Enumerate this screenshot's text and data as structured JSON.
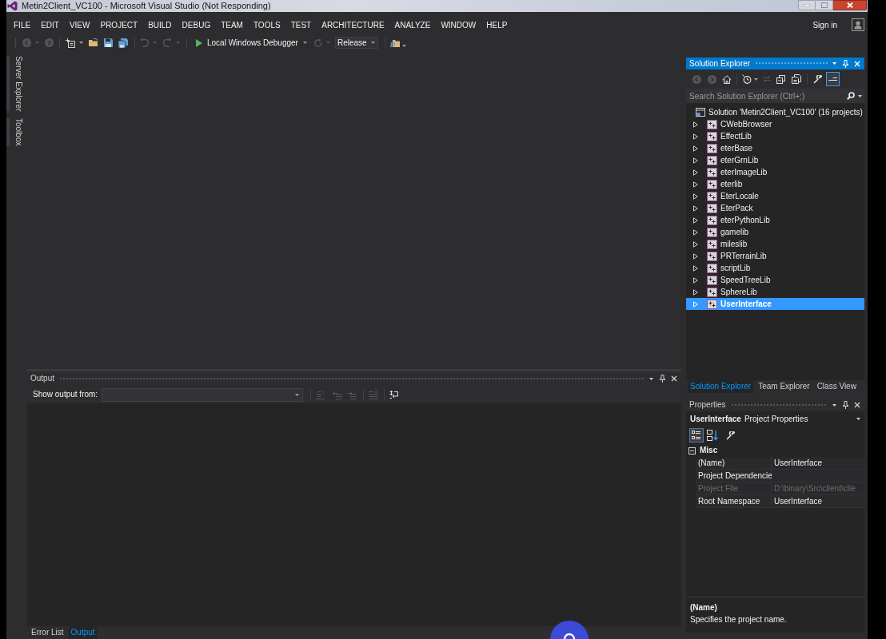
{
  "window": {
    "title": "Metin2Client_VC100 - Microsoft Visual Studio (Not Responding)"
  },
  "menu": [
    "FILE",
    "EDIT",
    "VIEW",
    "PROJECT",
    "BUILD",
    "DEBUG",
    "TEAM",
    "TOOLS",
    "TEST",
    "ARCHITECTURE",
    "ANALYZE",
    "WINDOW",
    "HELP"
  ],
  "account": {
    "sign_in": "Sign in"
  },
  "toolbar": {
    "start_debugging": "Local Windows Debugger",
    "configuration": "Release"
  },
  "side_tabs": [
    "Server Explorer",
    "Toolbox"
  ],
  "solution_explorer": {
    "title": "Solution Explorer",
    "active": true,
    "search": {
      "placeholder": "Search Solution Explorer (Ctrl+;)"
    },
    "solution": "Solution 'Metin2Client_VC100' (16 projects)",
    "projects": [
      {
        "name": "CWebBrowser",
        "expanded": false,
        "selected": false
      },
      {
        "name": "EffectLib",
        "expanded": false,
        "selected": false
      },
      {
        "name": "eterBase",
        "expanded": false,
        "selected": false
      },
      {
        "name": "eterGrnLib",
        "expanded": false,
        "selected": false
      },
      {
        "name": "eterImageLib",
        "expanded": false,
        "selected": false
      },
      {
        "name": "eterlib",
        "expanded": false,
        "selected": false
      },
      {
        "name": "EterLocale",
        "expanded": false,
        "selected": false
      },
      {
        "name": "EterPack",
        "expanded": false,
        "selected": false
      },
      {
        "name": "eterPythonLib",
        "expanded": false,
        "selected": false
      },
      {
        "name": "gamelib",
        "expanded": false,
        "selected": false
      },
      {
        "name": "mileslib",
        "expanded": false,
        "selected": false
      },
      {
        "name": "PRTerrainLib",
        "expanded": false,
        "selected": false
      },
      {
        "name": "scriptLib",
        "expanded": false,
        "selected": false
      },
      {
        "name": "SpeedTreeLib",
        "expanded": false,
        "selected": false
      },
      {
        "name": "SphereLib",
        "expanded": false,
        "selected": false
      },
      {
        "name": "UserInterface",
        "expanded": false,
        "selected": true
      }
    ],
    "tabs": [
      {
        "label": "Solution Explorer",
        "selected": true
      },
      {
        "label": "Team Explorer",
        "selected": false
      },
      {
        "label": "Class View",
        "selected": false
      }
    ]
  },
  "output": {
    "title": "Output",
    "active": false,
    "source_label": "Show output from:",
    "tabs": [
      {
        "label": "Error List",
        "selected": false
      },
      {
        "label": "Output",
        "selected": true
      }
    ]
  },
  "properties": {
    "title": "Properties",
    "active": false,
    "object": {
      "name": "UserInterface",
      "type": "Project Properties"
    },
    "category": {
      "label": "Misc",
      "expanded": true
    },
    "rows": [
      {
        "name": "(Name)",
        "value": "UserInterface",
        "disabled": false
      },
      {
        "name": "Project Dependencie",
        "disabled": false
      },
      {
        "name": "Project File",
        "value": "D:\\binary\\Src\\client\\clie",
        "disabled": true
      },
      {
        "name": "Root Namespace",
        "value": "UserInterface",
        "disabled": false
      }
    ],
    "description": {
      "title": "(Name)",
      "text": "Specifies the project name."
    }
  }
}
